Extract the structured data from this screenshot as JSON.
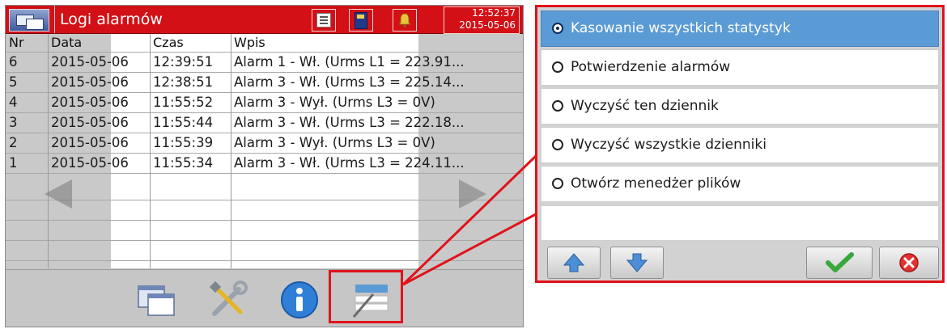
{
  "screen": {
    "title": "Logi alarmów",
    "clock": {
      "time": "12:52:37",
      "date": "2015-05-06"
    },
    "icons": [
      "window-icon",
      "list-icon",
      "sd-card-icon",
      "bell-icon"
    ]
  },
  "table": {
    "columns": [
      "Nr",
      "Data",
      "Czas",
      "Wpis"
    ],
    "rows": [
      {
        "nr": "6",
        "data": "2015-05-06",
        "czas": "12:39:51",
        "wpis": "Alarm 1 - Wł. (Urms L1 = 223.91..."
      },
      {
        "nr": "5",
        "data": "2015-05-06",
        "czas": "12:38:51",
        "wpis": "Alarm 3 - Wł. (Urms L3 = 225.14..."
      },
      {
        "nr": "4",
        "data": "2015-05-06",
        "czas": "11:55:52",
        "wpis": "Alarm 3 - Wył. (Urms L3 = 0V)"
      },
      {
        "nr": "3",
        "data": "2015-05-06",
        "czas": "11:55:44",
        "wpis": "Alarm 3 - Wł. (Urms L3 = 222.18..."
      },
      {
        "nr": "2",
        "data": "2015-05-06",
        "czas": "11:55:39",
        "wpis": "Alarm 3 - Wył. (Urms L3 = 0V)"
      },
      {
        "nr": "1",
        "data": "2015-05-06",
        "czas": "11:55:34",
        "wpis": "Alarm 3 - Wł. (Urms L3 = 224.11..."
      }
    ]
  },
  "bottom_icons": [
    "windows-icon",
    "tools-icon",
    "info-icon",
    "menu-edit-icon"
  ],
  "menu": {
    "options": [
      {
        "label": "Kasowanie wszystkich statystyk",
        "selected": true
      },
      {
        "label": "Potwierdzenie alarmów",
        "selected": false
      },
      {
        "label": "Wyczyść ten dziennik",
        "selected": false
      },
      {
        "label": "Wyczyść wszystkie dzienniki",
        "selected": false
      },
      {
        "label": "Otwórz menedżer plików",
        "selected": false
      }
    ],
    "buttons": [
      "arrow-up-icon",
      "arrow-down-icon",
      "checkmark-icon",
      "cancel-icon"
    ]
  },
  "colors": {
    "accent_red": "#d21016",
    "selection_blue": "#5b9bd5",
    "highlight_red": "#e0121a"
  }
}
